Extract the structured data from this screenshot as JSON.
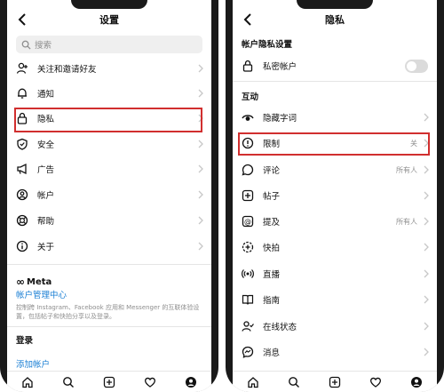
{
  "left": {
    "title": "设置",
    "search_placeholder": "搜索",
    "items": [
      {
        "label": "关注和邀请好友",
        "icon": "add-person-icon"
      },
      {
        "label": "通知",
        "icon": "bell-icon"
      },
      {
        "label": "隐私",
        "icon": "lock-icon"
      },
      {
        "label": "安全",
        "icon": "shield-icon"
      },
      {
        "label": "广告",
        "icon": "megaphone-icon"
      },
      {
        "label": "帐户",
        "icon": "account-icon"
      },
      {
        "label": "帮助",
        "icon": "lifebuoy-icon"
      },
      {
        "label": "关于",
        "icon": "info-icon"
      }
    ],
    "meta_brand": "Meta",
    "accounts_center": "帐户管理中心",
    "meta_description": "控制跨 Instagram、Facebook 应用和 Messenger 的互联体验设置，包括帖子和快拍分享以及登录。",
    "login_title": "登录",
    "add_account": "添加帐户"
  },
  "right": {
    "title": "隐私",
    "account_privacy_title": "帐户隐私设置",
    "private_account_label": "私密帐户",
    "interactions_title": "互动",
    "items": [
      {
        "label": "隐藏字词",
        "icon": "eye-icon",
        "value": ""
      },
      {
        "label": "限制",
        "icon": "restrict-icon",
        "value": "关"
      },
      {
        "label": "评论",
        "icon": "comment-icon",
        "value": "所有人"
      },
      {
        "label": "帖子",
        "icon": "post-add-icon",
        "value": ""
      },
      {
        "label": "提及",
        "icon": "at-icon",
        "value": "所有人"
      },
      {
        "label": "快拍",
        "icon": "story-icon",
        "value": ""
      },
      {
        "label": "直播",
        "icon": "live-icon",
        "value": ""
      },
      {
        "label": "指南",
        "icon": "guide-icon",
        "value": ""
      },
      {
        "label": "在线状态",
        "icon": "activity-icon",
        "value": ""
      },
      {
        "label": "消息",
        "icon": "messenger-icon",
        "value": ""
      }
    ]
  },
  "colors": {
    "highlight": "#d12f2f",
    "link": "#1a7fd4",
    "muted": "#8e8e8e"
  }
}
